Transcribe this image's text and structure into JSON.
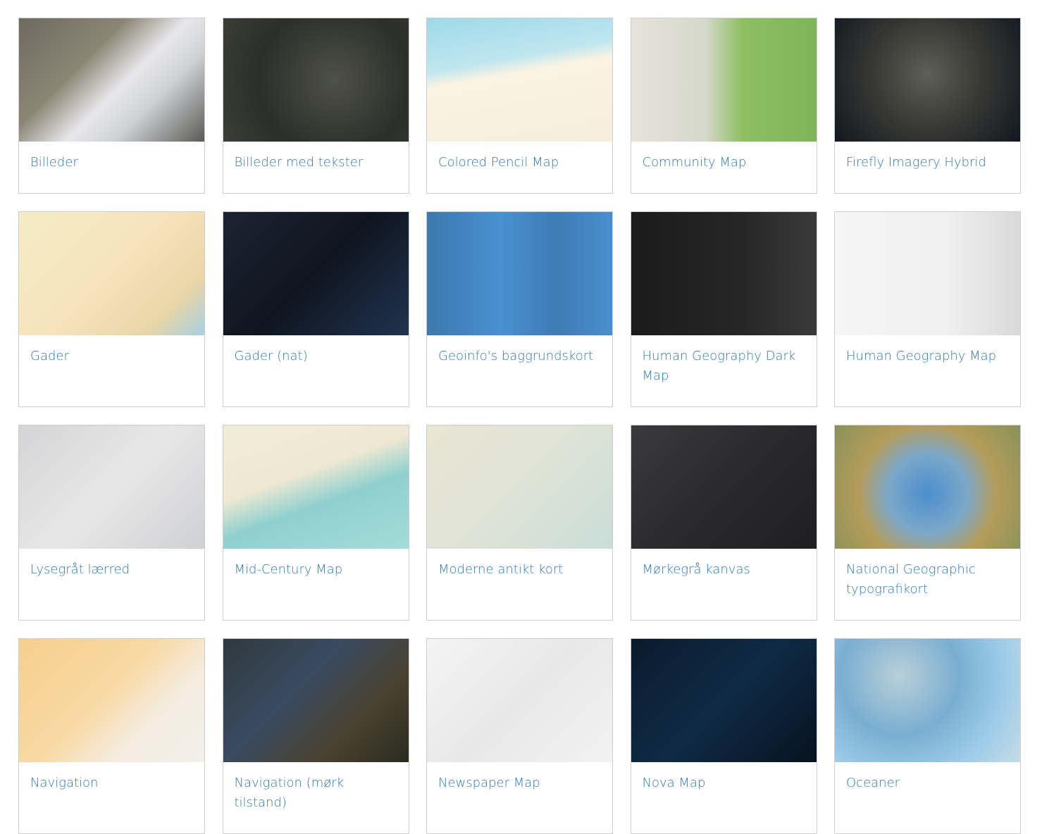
{
  "gallery": {
    "cards": [
      {
        "title": "Billeder"
      },
      {
        "title": "Billeder med tekster"
      },
      {
        "title": "Colored Pencil Map"
      },
      {
        "title": "Community Map"
      },
      {
        "title": "Firefly Imagery Hybrid"
      },
      {
        "title": "Gader"
      },
      {
        "title": "Gader (nat)"
      },
      {
        "title": "Geoinfo's baggrundskort"
      },
      {
        "title": "Human Geography Dark Map"
      },
      {
        "title": "Human Geography Map"
      },
      {
        "title": "Lysegråt lærred"
      },
      {
        "title": "Mid-Century Map"
      },
      {
        "title": "Moderne antikt kort"
      },
      {
        "title": "Mørkegrå kanvas"
      },
      {
        "title": "National Geographic typografikort"
      },
      {
        "title": "Navigation"
      },
      {
        "title": "Navigation (mørk tilstand)"
      },
      {
        "title": "Newspaper Map"
      },
      {
        "title": "Nova Map"
      },
      {
        "title": "Oceaner"
      }
    ]
  }
}
